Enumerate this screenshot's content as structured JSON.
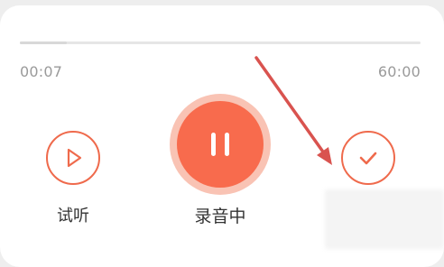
{
  "player": {
    "progress_fraction": 0.117,
    "elapsed": "00:07",
    "total": "60:00"
  },
  "controls": {
    "play_label": "试听",
    "record_label": "录音中",
    "play_icon": "play-icon",
    "pause_icon": "pause-icon",
    "confirm_icon": "check-icon"
  },
  "colors": {
    "accent": "#ef6a4c",
    "pause_fill": "#f86b4d",
    "pause_halo": "#f9c3b4",
    "annotation_arrow": "#d9534f"
  }
}
